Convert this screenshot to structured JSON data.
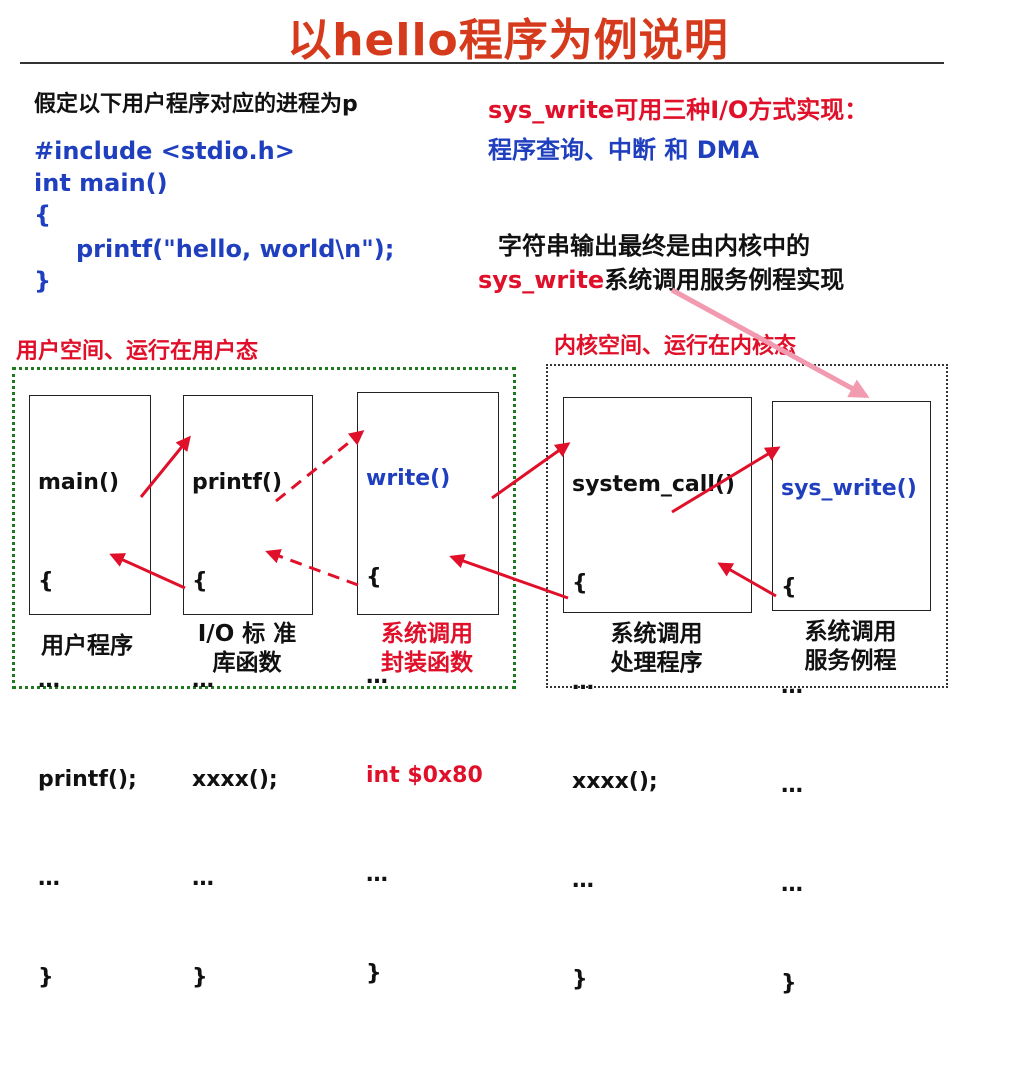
{
  "title": "以hello程序为例说明",
  "intro": "假定以下用户程序对应的进程为p",
  "code": {
    "line1": "#include <stdio.h>",
    "line2": "int main()",
    "line3": "{",
    "line4": "printf(\"hello, world\\n\");",
    "line5": "}"
  },
  "note1": {
    "line1": "sys_write可用三种I/O方式实现：",
    "line2": "程序查询、中断 和 DMA"
  },
  "note2": {
    "line1": "字符串输出最终是由内核中的",
    "line2_red": "sys_write",
    "line2_black": "系统调用服务例程实现"
  },
  "user_space_label": "用户空间、运行在用户态",
  "kernel_space_label": "内核空间、运行在内核态",
  "boxes": {
    "main": {
      "l1": "main()",
      "l2": "{",
      "l3": "…",
      "l4": "printf();",
      "l5": "…",
      "l6": "}",
      "caption": "用户程序"
    },
    "printf": {
      "l1": "printf()",
      "l2": "{",
      "l3": "…",
      "l4": "xxxx();",
      "l5": "…",
      "l6": "}",
      "caption": "I/O 标 准\n库函数"
    },
    "write": {
      "l1": "write()",
      "l2": "{",
      "l3": "…",
      "l4": "int $0x80",
      "l5": "…",
      "l6": "}",
      "caption": "系统调用\n封装函数"
    },
    "system_call": {
      "l1": "system_call()",
      "l2": "{",
      "l3": "…",
      "l4": "xxxx();",
      "l5": "…",
      "l6": "}",
      "caption": "系统调用\n处理程序"
    },
    "sys_write": {
      "l1": "sys_write()",
      "l2": "{",
      "l3": "…",
      "l4": "…",
      "l5": "…",
      "l6": "}",
      "caption": "系统调用\n服务例程"
    }
  },
  "colors": {
    "title": "#d63a1c",
    "blue": "#1f3fbf",
    "red": "#e0102a",
    "arrow": "#e0102a",
    "pink_arrow": "#f29ab0",
    "user_region": "#1d7a1d"
  }
}
